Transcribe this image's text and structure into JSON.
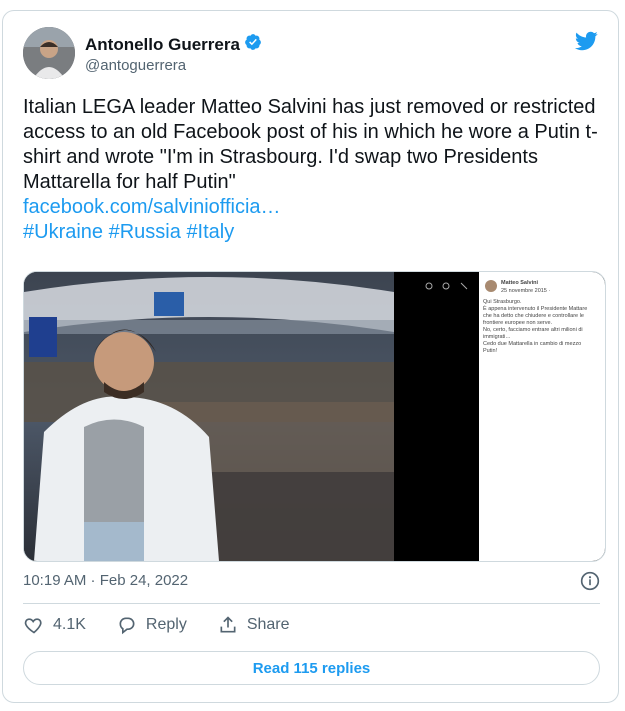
{
  "author": {
    "name": "Antonello Guerrera",
    "handle": "@antoguerrera",
    "verified": true
  },
  "tweet": {
    "body": "Italian LEGA leader Matteo Salvini has just removed or restricted access to an old Facebook post of his in which he wore a Putin t-shirt and wrote \"I'm in Strasbourg. I'd swap two Presidents Mattarella for half Putin\"",
    "link": "facebook.com/salviniofficia…",
    "hashtags": [
      "#Ukraine",
      "#Russia",
      "#Italy"
    ]
  },
  "media": {
    "fb_post": {
      "author": "Matteo Salvini",
      "date": "25 novembre 2015 ·",
      "lines": [
        "Qui Strasburgo.",
        "È appena intervenuto il Presidente Mattare",
        "che ha detto che chiudere e controllare le",
        "frontiere europee non serve.",
        "No, certo, facciamo entrare altri milioni di",
        "immigrati…",
        "Cedo due Mattarella in cambio di mezzo",
        "Putin!"
      ]
    }
  },
  "meta": {
    "timestamp": "10:19 AM · Feb 24, 2022"
  },
  "actions": {
    "likes": "4.1K",
    "reply_label": "Reply",
    "share_label": "Share"
  },
  "read_replies": "Read 115 replies",
  "colors": {
    "accent": "#1d9bf0",
    "text": "#0f1419",
    "muted": "#536471",
    "border": "#cfd9de"
  }
}
